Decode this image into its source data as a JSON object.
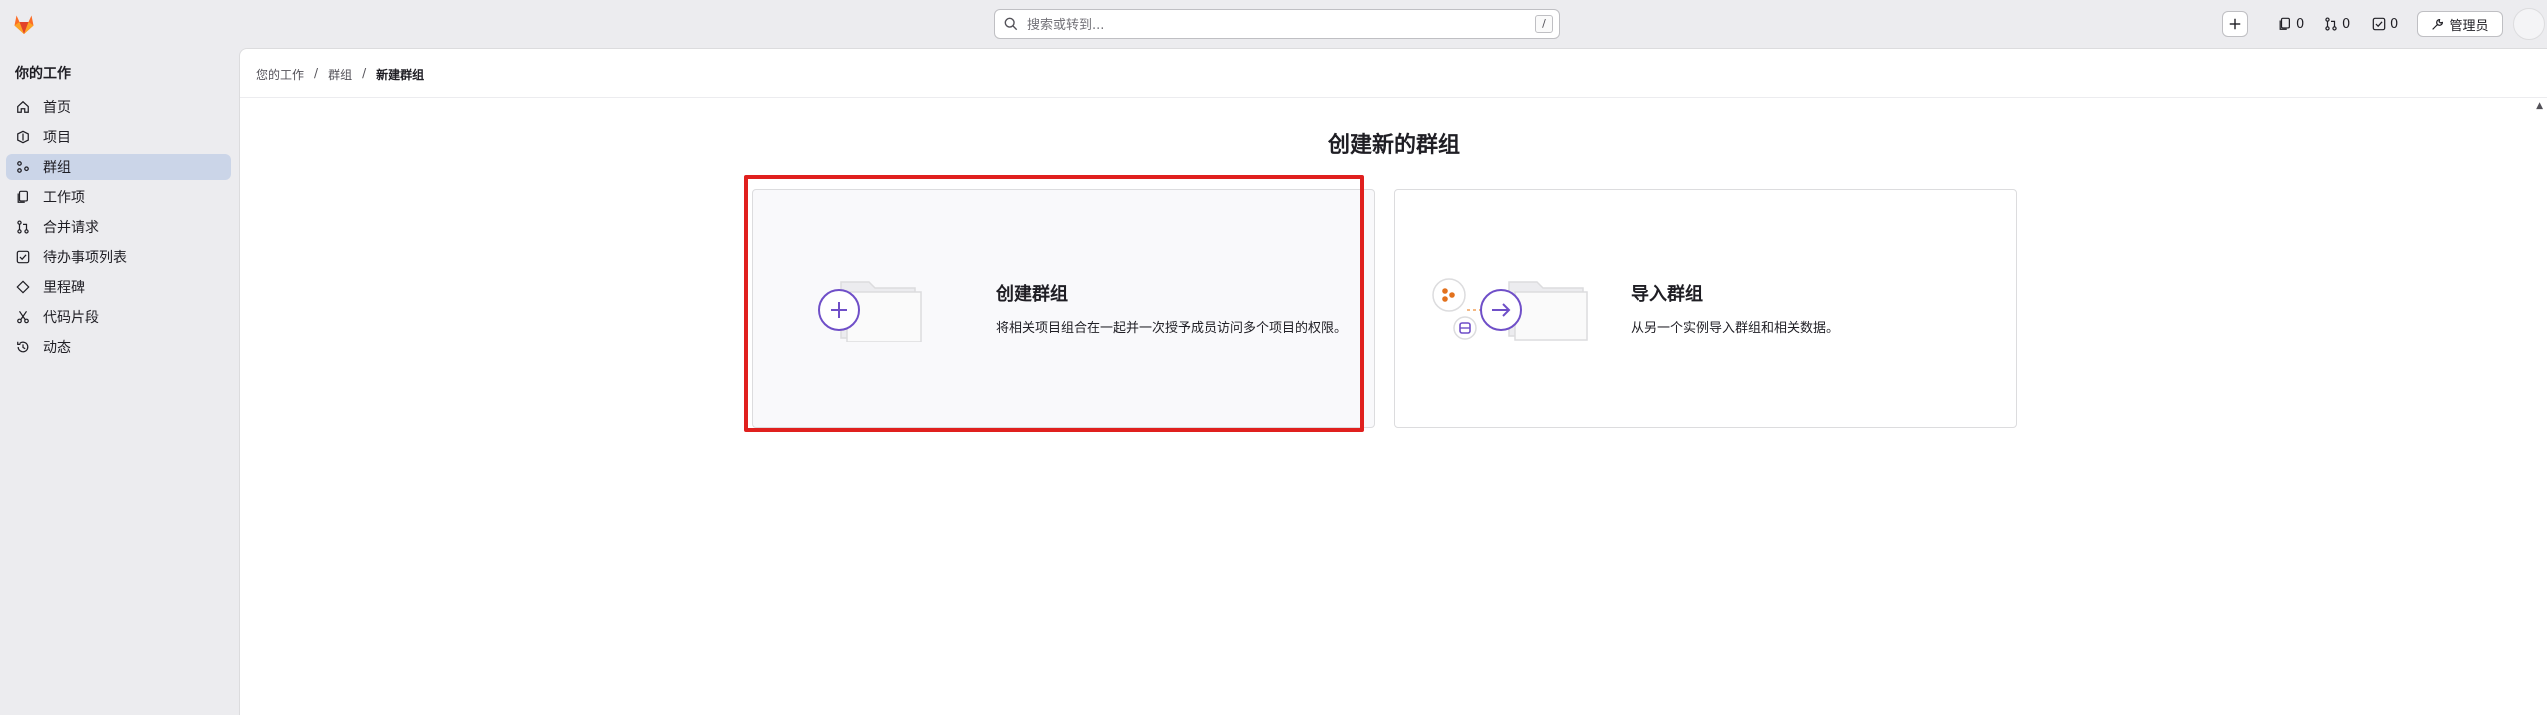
{
  "topbar": {
    "search_placeholder": "搜索或转到...",
    "search_shortcut": "/",
    "issues_count": "0",
    "merge_requests_count": "0",
    "todos_count": "0",
    "admin_label": "管理员"
  },
  "sidebar": {
    "title": "你的工作",
    "items": [
      {
        "label": "首页",
        "icon": "home-icon"
      },
      {
        "label": "项目",
        "icon": "project-icon"
      },
      {
        "label": "群组",
        "icon": "group-icon",
        "active": true
      },
      {
        "label": "工作项",
        "icon": "work-items-icon"
      },
      {
        "label": "合并请求",
        "icon": "merge-request-icon"
      },
      {
        "label": "待办事项列表",
        "icon": "todo-icon"
      },
      {
        "label": "里程碑",
        "icon": "milestone-icon"
      },
      {
        "label": "代码片段",
        "icon": "snippet-icon"
      },
      {
        "label": "动态",
        "icon": "history-icon"
      }
    ]
  },
  "breadcrumb": {
    "items": [
      "您的工作",
      "群组",
      "新建群组"
    ],
    "separator": "/"
  },
  "main": {
    "title": "创建新的群组",
    "cards": [
      {
        "title": "创建群组",
        "description": "将相关项目组合在一起并一次授予成员访问多个项目的权限。"
      },
      {
        "title": "导入群组",
        "description": "从另一个实例导入群组和相关数据。"
      }
    ]
  },
  "colors": {
    "accent_purple": "#6f4fc8",
    "highlight_red": "#e0201e",
    "logo_orange": "#e24329"
  }
}
